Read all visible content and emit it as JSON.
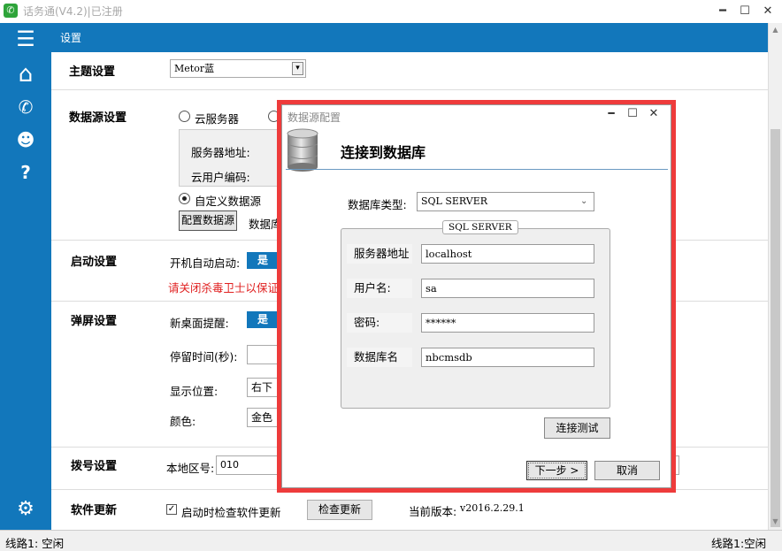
{
  "window": {
    "title": "话务通(V4.2)|已注册",
    "min": "━",
    "max": "☐",
    "close": "✕"
  },
  "sidebar": {
    "menu": "☰",
    "home": "⌂",
    "phone": "✆",
    "user": "☻",
    "help": "?",
    "settings": "⚙"
  },
  "header": {
    "title": "设置"
  },
  "theme": {
    "title": "主题设置",
    "value": "Metor蓝",
    "arrow": "▾"
  },
  "datasource": {
    "title": "数据源设置",
    "radio_cloud": "云服务器",
    "server_addr_label": "服务器地址:",
    "cloud_user_label": "云用户编码:",
    "radio_custom": "自定义数据源",
    "config_button": "配置数据源",
    "db_label": "数据库"
  },
  "startup": {
    "title": "启动设置",
    "autostart_label": "开机自动启动:",
    "autostart_value": "是",
    "warning": "请关闭杀毒卫士以保证设"
  },
  "popup": {
    "title": "弹屏设置",
    "desktop_label": "新桌面提醒:",
    "desktop_value": "是",
    "stay_label": "停留时间(秒):",
    "position_label": "显示位置:",
    "position_value": "右下",
    "color_label": "颜色:",
    "color_value": "金色"
  },
  "dial": {
    "title": "拨号设置",
    "area_label": "本地区号:",
    "area_value": "010"
  },
  "update": {
    "title": "软件更新",
    "check_label": "启动时检查软件更新",
    "check_mark": "✓",
    "check_button": "检查更新",
    "version_label": "当前版本:",
    "version_value": "v2016.2.29.1"
  },
  "statusbar": {
    "left": "线路1: 空闲",
    "right": "线路1:空闲"
  },
  "dialog": {
    "title": "数据源配置",
    "heading": "连接到数据库",
    "db_type_label": "数据库类型:",
    "db_type_value": "SQL SERVER",
    "group_title": "SQL SERVER",
    "server_label": "服务器地址",
    "server_value": "localhost",
    "user_label": "用户名:",
    "user_value": "sa",
    "password_label": "密码:",
    "password_value": "******",
    "dbname_label": "数据库名",
    "dbname_value": "nbcmsdb",
    "test_button": "连接测试",
    "next_button": "下一步 >",
    "cancel_button": "取消"
  },
  "colors": {
    "accent": "#1277bb",
    "highlight": "#ee3b3b",
    "warning": "#e02020"
  }
}
